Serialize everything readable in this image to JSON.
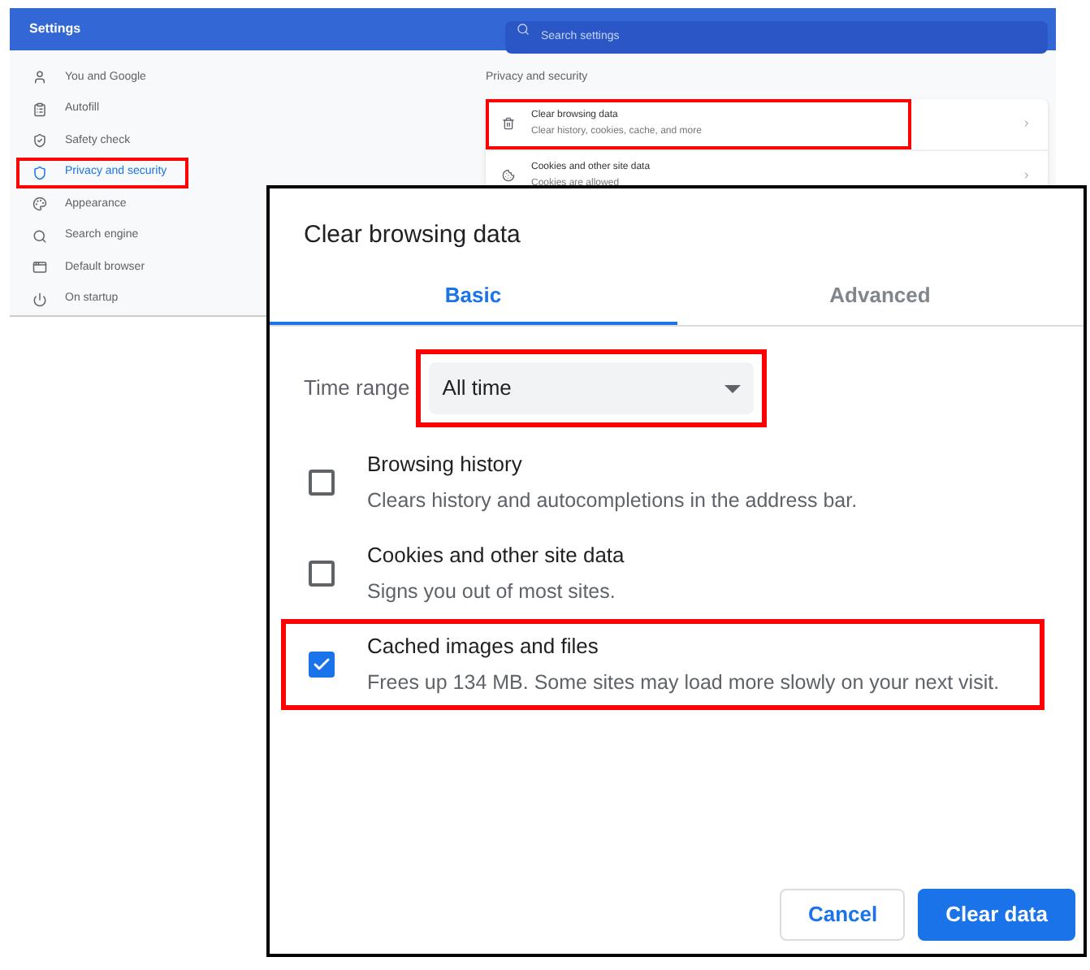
{
  "settings": {
    "title": "Settings",
    "search": {
      "placeholder": "Search settings"
    },
    "sidebar": {
      "items": [
        {
          "label": "You and Google",
          "selected": false,
          "highlighted": false
        },
        {
          "label": "Autofill",
          "selected": false,
          "highlighted": false
        },
        {
          "label": "Safety check",
          "selected": false,
          "highlighted": false
        },
        {
          "label": "Privacy and security",
          "selected": true,
          "highlighted": true
        },
        {
          "label": "Appearance",
          "selected": false,
          "highlighted": false
        },
        {
          "label": "Search engine",
          "selected": false,
          "highlighted": false
        },
        {
          "label": "Default browser",
          "selected": false,
          "highlighted": false
        },
        {
          "label": "On startup",
          "selected": false,
          "highlighted": false
        }
      ]
    },
    "section": {
      "title": "Privacy and security",
      "rows": [
        {
          "title": "Clear browsing data",
          "subtitle": "Clear history, cookies, cache, and more",
          "highlighted": true
        },
        {
          "title": "Cookies and other site data",
          "subtitle": "Cookies are allowed",
          "highlighted": false
        }
      ]
    }
  },
  "dialog": {
    "title": "Clear browsing data",
    "tabs": [
      {
        "label": "Basic",
        "selected": true
      },
      {
        "label": "Advanced",
        "selected": false
      }
    ],
    "time_range": {
      "label": "Time range",
      "value": "All time",
      "highlighted": true
    },
    "options": [
      {
        "title": "Browsing history",
        "description": "Clears history and autocompletions in the address bar.",
        "checked": false,
        "highlighted": false
      },
      {
        "title": "Cookies and other site data",
        "description": "Signs you out of most sites.",
        "checked": false,
        "highlighted": false
      },
      {
        "title": "Cached images and files",
        "description": "Frees up 134 MB. Some sites may load more slowly on your next visit.",
        "checked": true,
        "highlighted": true
      }
    ],
    "buttons": [
      {
        "label": "Cancel",
        "kind": "secondary"
      },
      {
        "label": "Clear data",
        "kind": "primary"
      }
    ]
  }
}
